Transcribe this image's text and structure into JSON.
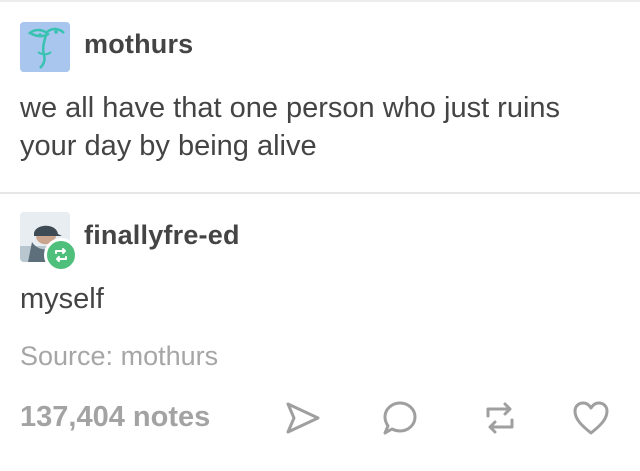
{
  "post": {
    "author": "mothurs",
    "text": "we all have that one person who just ruins your day by being alive",
    "avatar_icon": "abstract-face-avatar"
  },
  "reblog": {
    "author": "finallyfre-ed",
    "text": "myself",
    "avatar_icon": "cap-wearing-person-avatar",
    "badge_icon": "reblog-icon"
  },
  "source": {
    "label": "Source:",
    "name": "mothurs"
  },
  "footer": {
    "notes": "137,404 notes",
    "actions": [
      "share-icon",
      "reply-icon",
      "reblog-icon",
      "heart-icon"
    ]
  },
  "colors": {
    "text": "#444444",
    "muted": "#a6a6a6",
    "reblog_green": "#4fbf7c",
    "avatar_bg": "#a8c6ee",
    "avatar_ink": "#38c2b0"
  }
}
